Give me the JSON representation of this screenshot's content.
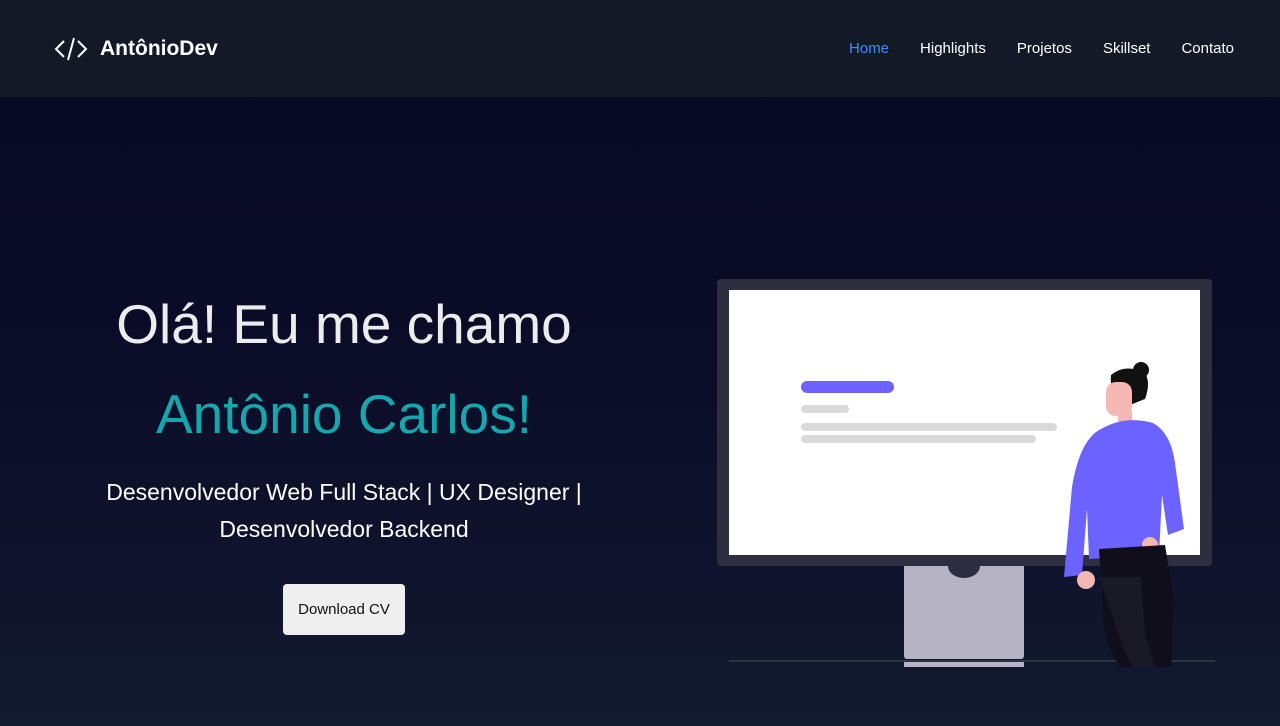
{
  "brand": {
    "name": "AntônioDev",
    "icon": "code-icon"
  },
  "nav": {
    "items": [
      {
        "label": "Home",
        "active": true
      },
      {
        "label": "Highlights",
        "active": false
      },
      {
        "label": "Projetos",
        "active": false
      },
      {
        "label": "Skillset",
        "active": false
      },
      {
        "label": "Contato",
        "active": false
      }
    ]
  },
  "hero": {
    "greeting": "Olá! Eu me chamo",
    "name": "Antônio Carlos!",
    "roles_line1": "Desenvolvedor Web Full Stack | UX Designer |",
    "roles_line2": "Desenvolvedor Backend",
    "cta_label": "Download CV"
  },
  "colors": {
    "nav_bg": "#121a28",
    "nav_active": "#3f8cff",
    "accent_name": "#15a7ad",
    "illustration_purple": "#6c63ff"
  }
}
